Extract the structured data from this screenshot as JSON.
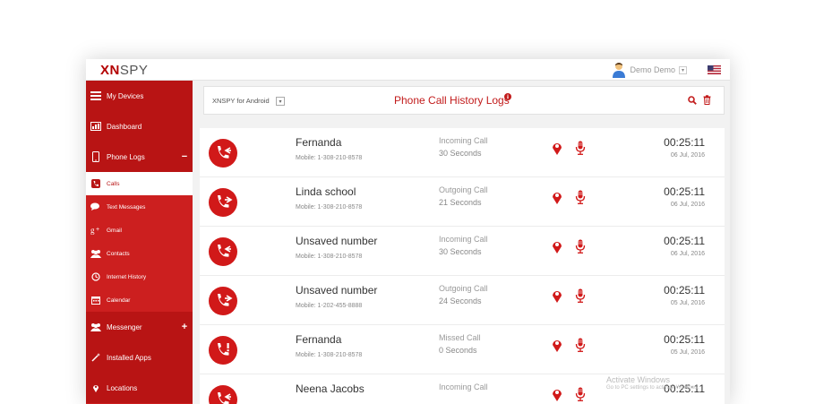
{
  "app": {
    "logo_x": "XN",
    "logo_rest": "SPY",
    "user_name": "Demo Demo",
    "user_caret": "▾"
  },
  "sidebar": {
    "items": [
      {
        "label": "My Devices",
        "icon": "devices-icon",
        "type": "main"
      },
      {
        "label": "Dashboard",
        "icon": "dashboard-icon",
        "type": "main"
      },
      {
        "label": "Phone Logs",
        "icon": "phone-icon",
        "type": "main",
        "toggle": "−"
      },
      {
        "label": "Calls",
        "icon": "call-icon",
        "type": "sub",
        "active": true
      },
      {
        "label": "Text Messages",
        "icon": "chat-icon",
        "type": "sub"
      },
      {
        "label": "Gmail",
        "icon": "google-plus-icon",
        "type": "sub"
      },
      {
        "label": "Contacts",
        "icon": "contacts-icon",
        "type": "sub"
      },
      {
        "label": "Internet History",
        "icon": "history-icon",
        "type": "sub"
      },
      {
        "label": "Calendar",
        "icon": "calendar-icon",
        "type": "sub"
      },
      {
        "label": "Messenger",
        "icon": "messenger-icon",
        "type": "main",
        "toggle": "+"
      },
      {
        "label": "Installed Apps",
        "icon": "magic-wand-icon",
        "type": "main"
      },
      {
        "label": "Locations",
        "icon": "location-icon",
        "type": "main"
      }
    ]
  },
  "header": {
    "device_label": "XNSPY for Android",
    "device_caret": "▾",
    "title": "Phone Call History Logs"
  },
  "calls": [
    {
      "name": "Fernanda",
      "mobile": "Mobile: 1-308-210-8578",
      "type": "Incoming Call",
      "duration": "30 Seconds",
      "time": "00:25:11",
      "date": "06 Jul, 2016",
      "direction": "incoming"
    },
    {
      "name": "Linda school",
      "mobile": "Mobile: 1-308-210-8578",
      "type": "Outgoing Call",
      "duration": "21 Seconds",
      "time": "00:25:11",
      "date": "06 Jul, 2016",
      "direction": "outgoing"
    },
    {
      "name": "Unsaved number",
      "mobile": "Mobile: 1-308-210-8578",
      "type": "Incoming Call",
      "duration": "30 Seconds",
      "time": "00:25:11",
      "date": "06 Jul, 2016",
      "direction": "incoming"
    },
    {
      "name": "Unsaved number",
      "mobile": "Mobile: 1-202-455-8888",
      "type": "Outgoing Call",
      "duration": "24 Seconds",
      "time": "00:25:11",
      "date": "05 Jul, 2016",
      "direction": "outgoing"
    },
    {
      "name": "Fernanda",
      "mobile": "Mobile: 1-308-210-8578",
      "type": "Missed Call",
      "duration": "0 Seconds",
      "time": "00:25:11",
      "date": "05 Jul, 2016",
      "direction": "missed"
    },
    {
      "name": "Neena Jacobs",
      "mobile": "",
      "type": "Incoming Call",
      "duration": "",
      "time": "00:25:11",
      "date": "",
      "direction": "incoming"
    }
  ],
  "watermark": {
    "title": "Activate Windows",
    "sub": "Go to PC settings to activate Windows."
  },
  "colors": {
    "accent": "#d11919",
    "sidebar": "#cc1f1f",
    "sidebar_main": "#b81414"
  }
}
